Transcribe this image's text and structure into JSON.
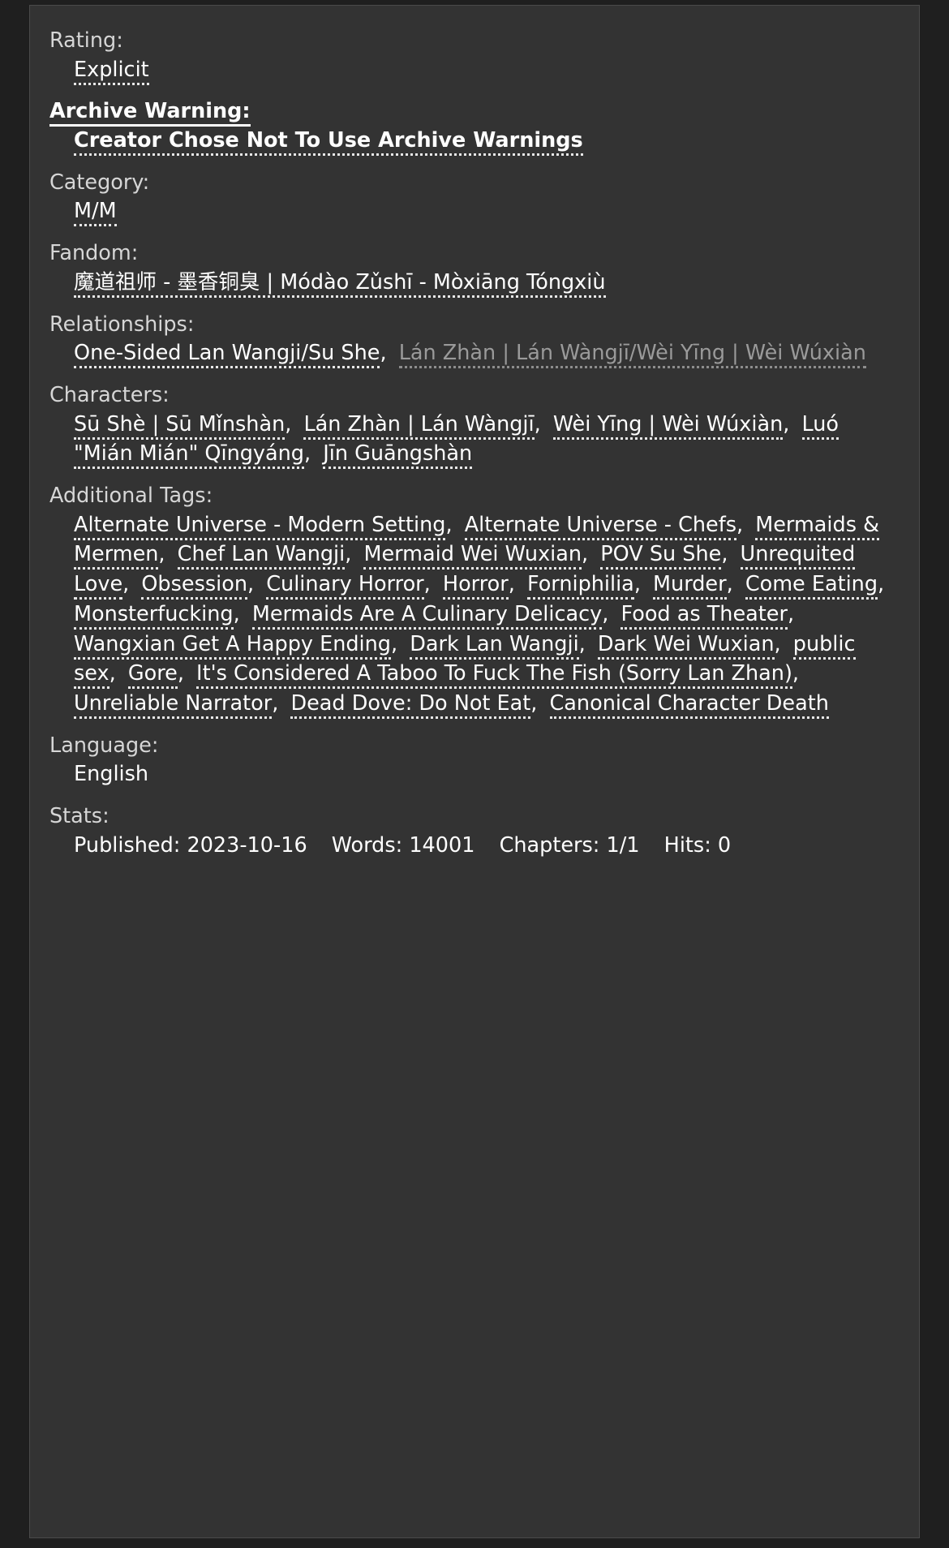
{
  "meta": {
    "rating": {
      "label": "Rating:",
      "values": [
        "Explicit"
      ]
    },
    "archive_warning": {
      "label": "Archive Warning:",
      "values": [
        "Creator Chose Not To Use Archive Warnings"
      ]
    },
    "category": {
      "label": "Category:",
      "values": [
        "M/M"
      ]
    },
    "fandom": {
      "label": "Fandom:",
      "values": [
        "魔道祖师 - 墨香铜臭 | Módào Zǔshī - Mòxiāng Tóngxiù"
      ]
    },
    "relationships": {
      "label": "Relationships:",
      "values": [
        {
          "text": "One-Sided Lan Wangji/Su She",
          "visited": false
        },
        {
          "text": "Lán Zhàn | Lán Wàngjī/Wèi Yīng | Wèi Wúxiàn",
          "visited": true
        }
      ]
    },
    "characters": {
      "label": "Characters:",
      "values": [
        "Sū Shè | Sū Mǐnshàn",
        "Lán Zhàn | Lán Wàngjī",
        "Wèi Yīng | Wèi Wúxiàn",
        "Luó \"Mián Mián\" Qīngyáng",
        "Jīn Guāngshàn"
      ]
    },
    "additional_tags": {
      "label": "Additional Tags:",
      "values": [
        "Alternate Universe - Modern Setting",
        "Alternate Universe - Chefs",
        "Mermaids & Mermen",
        "Chef Lan Wangji",
        "Mermaid Wei Wuxian",
        "POV Su She",
        "Unrequited Love",
        "Obsession",
        "Culinary Horror",
        "Horror",
        "Forniphilia",
        "Murder",
        "Come Eating",
        "Monsterfucking",
        "Mermaids Are A Culinary Delicacy",
        "Food as Theater",
        "Wangxian Get A Happy Ending",
        "Dark Lan Wangji",
        "Dark Wei Wuxian",
        "public sex",
        "Gore",
        "It's Considered A Taboo To Fuck The Fish (Sorry Lan Zhan)",
        "Unreliable Narrator",
        "Dead Dove: Do Not Eat",
        "Canonical Character Death"
      ]
    },
    "language": {
      "label": "Language:",
      "values": [
        "English"
      ]
    },
    "stats": {
      "label": "Stats:",
      "items": [
        {
          "name": "Published:",
          "value": "2023-10-16"
        },
        {
          "name": "Words:",
          "value": "14001"
        },
        {
          "name": "Chapters:",
          "value": "1/1"
        },
        {
          "name": "Hits:",
          "value": "0"
        }
      ]
    }
  },
  "colors": {
    "background": "#333333",
    "page_background": "#1f1f1f",
    "text": "#ffffff",
    "label": "#d6d6d6",
    "visited_link": "#9a9a9a"
  }
}
